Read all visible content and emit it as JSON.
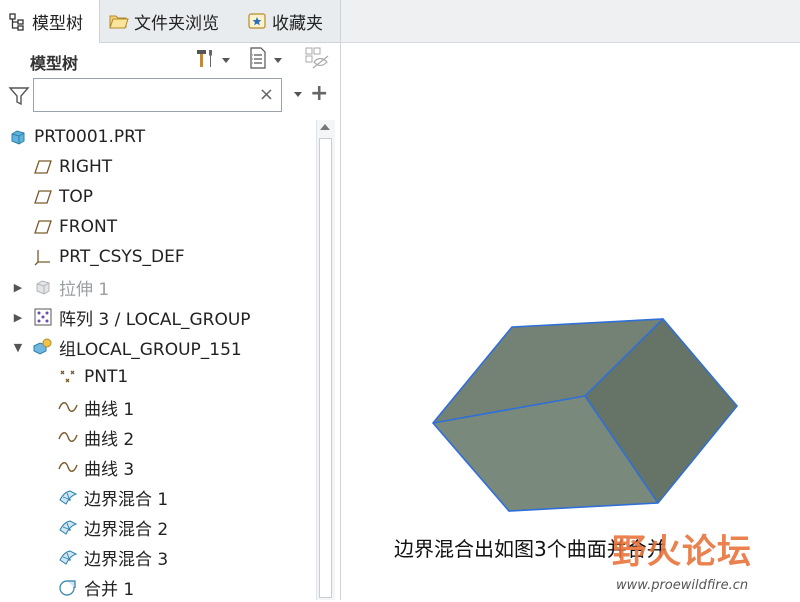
{
  "tabs": [
    {
      "label": "模型树",
      "icon": "model-tree-icon",
      "active": true
    },
    {
      "label": "文件夹浏览",
      "icon": "folder-browser-icon",
      "active": false
    },
    {
      "label": "收藏夹",
      "icon": "favorites-icon",
      "active": false
    }
  ],
  "panel": {
    "title": "模型树"
  },
  "search": {
    "value": "",
    "clear": "×",
    "add": "+"
  },
  "tree": [
    {
      "label": "PRT0001.PRT",
      "icon": "part-icon",
      "expander": ""
    },
    {
      "label": "RIGHT",
      "icon": "datum-plane-icon",
      "expander": ""
    },
    {
      "label": "TOP",
      "icon": "datum-plane-icon",
      "expander": ""
    },
    {
      "label": "FRONT",
      "icon": "datum-plane-icon",
      "expander": ""
    },
    {
      "label": "PRT_CSYS_DEF",
      "icon": "csys-icon",
      "expander": ""
    },
    {
      "label": "拉伸 1",
      "icon": "extrude-icon",
      "expander": "▶",
      "suppressed": true
    },
    {
      "label": "阵列 3 / LOCAL_GROUP",
      "icon": "pattern-icon",
      "expander": "▶"
    },
    {
      "label": "组LOCAL_GROUP_151",
      "icon": "group-icon",
      "expander": "▼"
    },
    {
      "label": "PNT1",
      "icon": "datum-point-icon",
      "expander": ""
    },
    {
      "label": "曲线 1",
      "icon": "curve-icon",
      "expander": ""
    },
    {
      "label": "曲线 2",
      "icon": "curve-icon",
      "expander": ""
    },
    {
      "label": "曲线 3",
      "icon": "curve-icon",
      "expander": ""
    },
    {
      "label": "边界混合 1",
      "icon": "boundary-blend-icon",
      "expander": ""
    },
    {
      "label": "边界混合 2",
      "icon": "boundary-blend-icon",
      "expander": ""
    },
    {
      "label": "边界混合 3",
      "icon": "boundary-blend-icon",
      "expander": ""
    },
    {
      "label": "合并 1",
      "icon": "merge-icon",
      "expander": ""
    }
  ],
  "viewport": {
    "caption": "边界混合出如图3个曲面并合并",
    "watermark_title": "野火论坛",
    "watermark_url": "www.proewildfire.cn"
  },
  "colors": {
    "surface_edge": "#2f6fd6",
    "face_top": "#738275",
    "face_left": "#79897c",
    "face_right": "#657466",
    "watermark": "#e8743b"
  }
}
